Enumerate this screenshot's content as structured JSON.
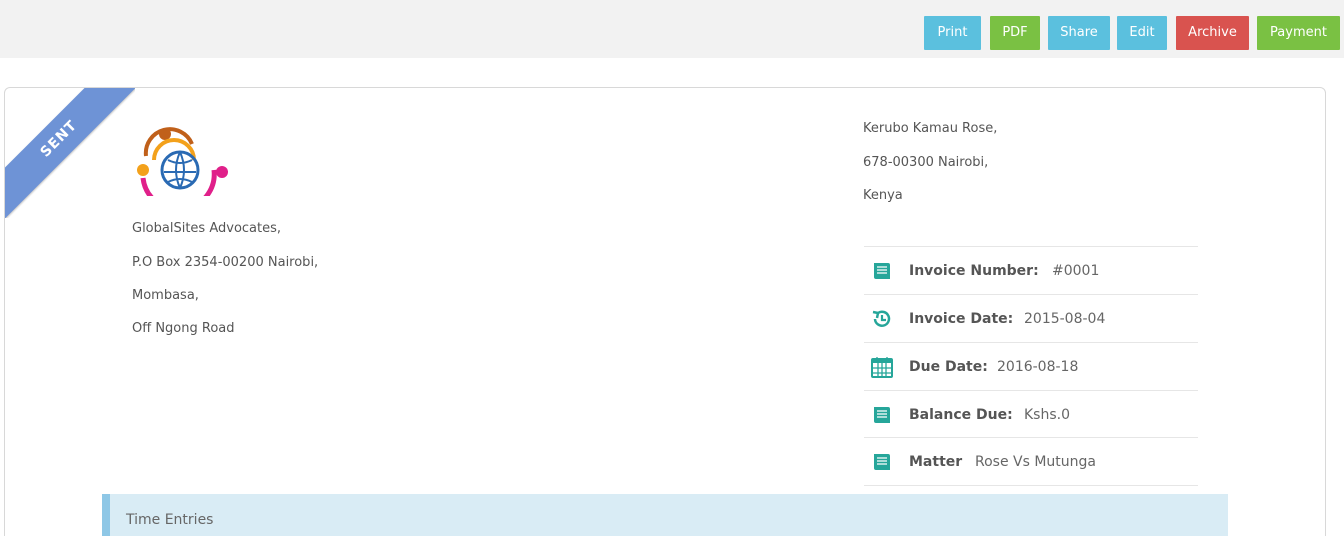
{
  "toolbar": {
    "print_label": "Print",
    "pdf_label": "PDF",
    "share_label": "Share",
    "edit_label": "Edit",
    "archive_label": "Archive",
    "payment_label": "Payment"
  },
  "status_ribbon": "SENT",
  "firm": {
    "lines": [
      "GlobalSites Advocates,",
      "P.O Box 2354-00200 Nairobi,",
      "Mombasa,",
      "Off Ngong Road"
    ]
  },
  "client": {
    "lines": [
      "Kerubo Kamau Rose,",
      "678-00300 Nairobi,",
      "Kenya"
    ]
  },
  "details": [
    {
      "icon": "book-icon",
      "label": "Invoice Number:",
      "value": "#0001"
    },
    {
      "icon": "history-icon",
      "label": "Invoice Date:",
      "value": "2015-08-04"
    },
    {
      "icon": "calendar-icon",
      "label": "Due Date:",
      "value": "2016-08-18"
    },
    {
      "icon": "book-icon",
      "label": "Balance Due:",
      "value": "Kshs.0"
    },
    {
      "icon": "book-icon",
      "label": "Matter",
      "value": "Rose Vs Mutunga"
    }
  ],
  "time_entries_title": "Time Entries",
  "colors": {
    "accent_teal": "#26a69a",
    "ribbon": "#6e93d6",
    "btn_blue": "#5bc0de",
    "btn_green": "#7ac143",
    "btn_red": "#d9534f"
  }
}
